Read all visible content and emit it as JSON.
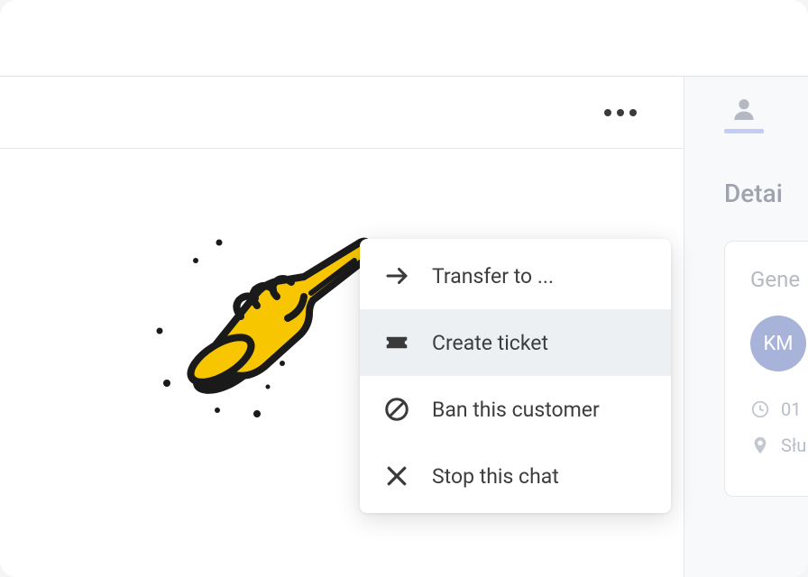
{
  "menu": {
    "items": [
      {
        "label": "Transfer to ..."
      },
      {
        "label": "Create ticket"
      },
      {
        "label": "Ban this customer"
      },
      {
        "label": "Stop this chat"
      }
    ]
  },
  "sidebar": {
    "details_title": "Detai",
    "card_heading": "Gene",
    "avatar_initials": "KM",
    "time_value": "01",
    "location_value": "Słu"
  }
}
